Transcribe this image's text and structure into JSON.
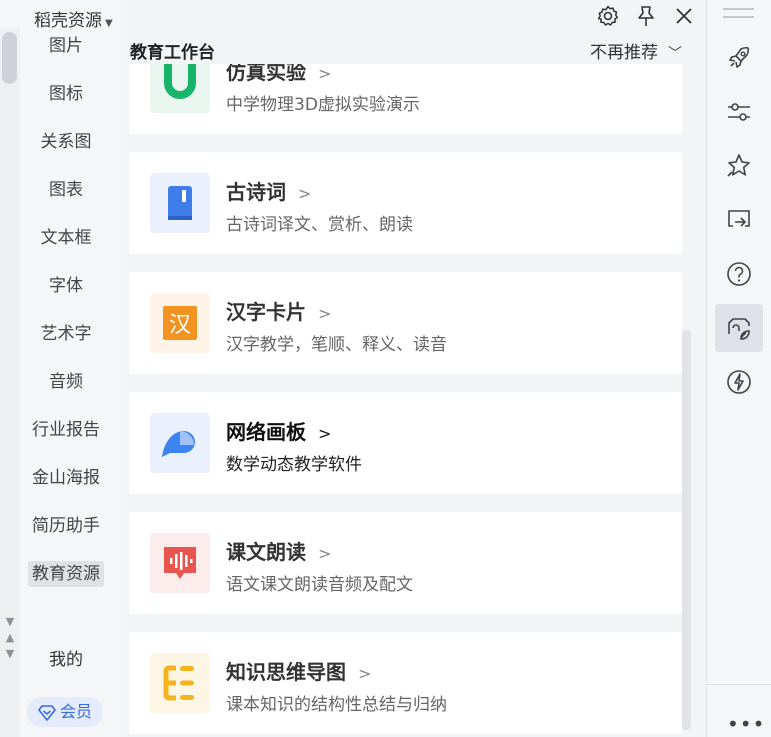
{
  "brand": {
    "title": "稻壳资源"
  },
  "sidebar": {
    "items": [
      {
        "label": "图片"
      },
      {
        "label": "图标"
      },
      {
        "label": "关系图"
      },
      {
        "label": "图表"
      },
      {
        "label": "文本框"
      },
      {
        "label": "字体"
      },
      {
        "label": "艺术字"
      },
      {
        "label": "音频"
      },
      {
        "label": "行业报告"
      },
      {
        "label": "金山海报"
      },
      {
        "label": "简历助手"
      },
      {
        "label": "教育资源"
      }
    ],
    "active_index": 11,
    "mine_label": "我的",
    "vip_label": "会员"
  },
  "main": {
    "title": "教育工作台",
    "no_recommend_label": "不再推荐",
    "cards": [
      {
        "title": "仿真实验",
        "desc": "中学物理3D虚拟实验演示",
        "icon": "magnet-icon",
        "color": "#18b46b"
      },
      {
        "title": "古诗词",
        "desc": "古诗词译文、赏析、朗读",
        "icon": "book-icon",
        "color": "#3f7de8"
      },
      {
        "title": "汉字卡片",
        "desc": "汉字教学，笔顺、释义、读音",
        "icon": "hanzi-card-icon",
        "color": "#f39322",
        "glyph": "汉"
      },
      {
        "title": "网络画板",
        "desc": "数学动态教学软件",
        "icon": "draw-board-icon",
        "color": "#3c84ef"
      },
      {
        "title": "课文朗读",
        "desc": "语文课文朗读音频及配文",
        "icon": "audio-read-icon",
        "color": "#e8554e"
      },
      {
        "title": "知识思维导图",
        "desc": "课本知识的结构性总结与归纳",
        "icon": "mindmap-icon",
        "color": "#f5b41d"
      }
    ]
  },
  "right_toolbar": {
    "icons": [
      "rocket-icon",
      "sliders-icon",
      "star-icon",
      "screen-cast-icon",
      "help-icon",
      "eco-hand-icon",
      "lightning-icon"
    ],
    "active": "eco-hand-icon",
    "more": "•••"
  }
}
